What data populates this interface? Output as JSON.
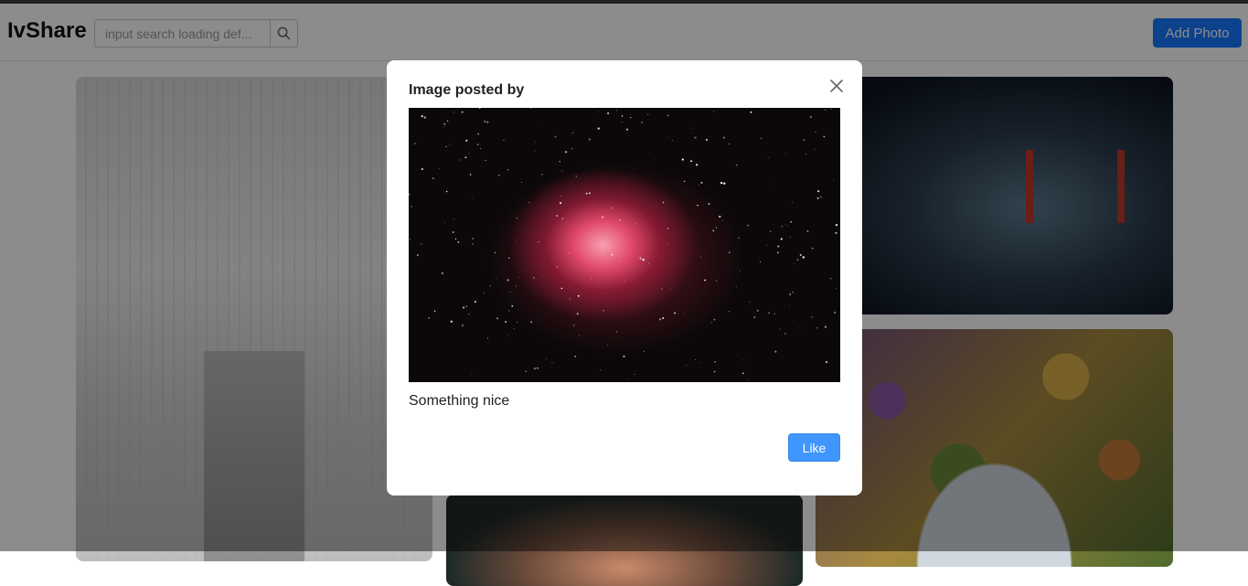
{
  "header": {
    "logo": "IvShare",
    "search_placeholder": "input search loading def...",
    "search_icon": "search-icon",
    "add_photo_label": "Add Photo"
  },
  "modal": {
    "title": "Image posted by",
    "close_icon": "close-icon",
    "caption": "Something nice",
    "like_label": "Like"
  },
  "colors": {
    "primary": "#1677ff",
    "like": "#4096ff"
  }
}
